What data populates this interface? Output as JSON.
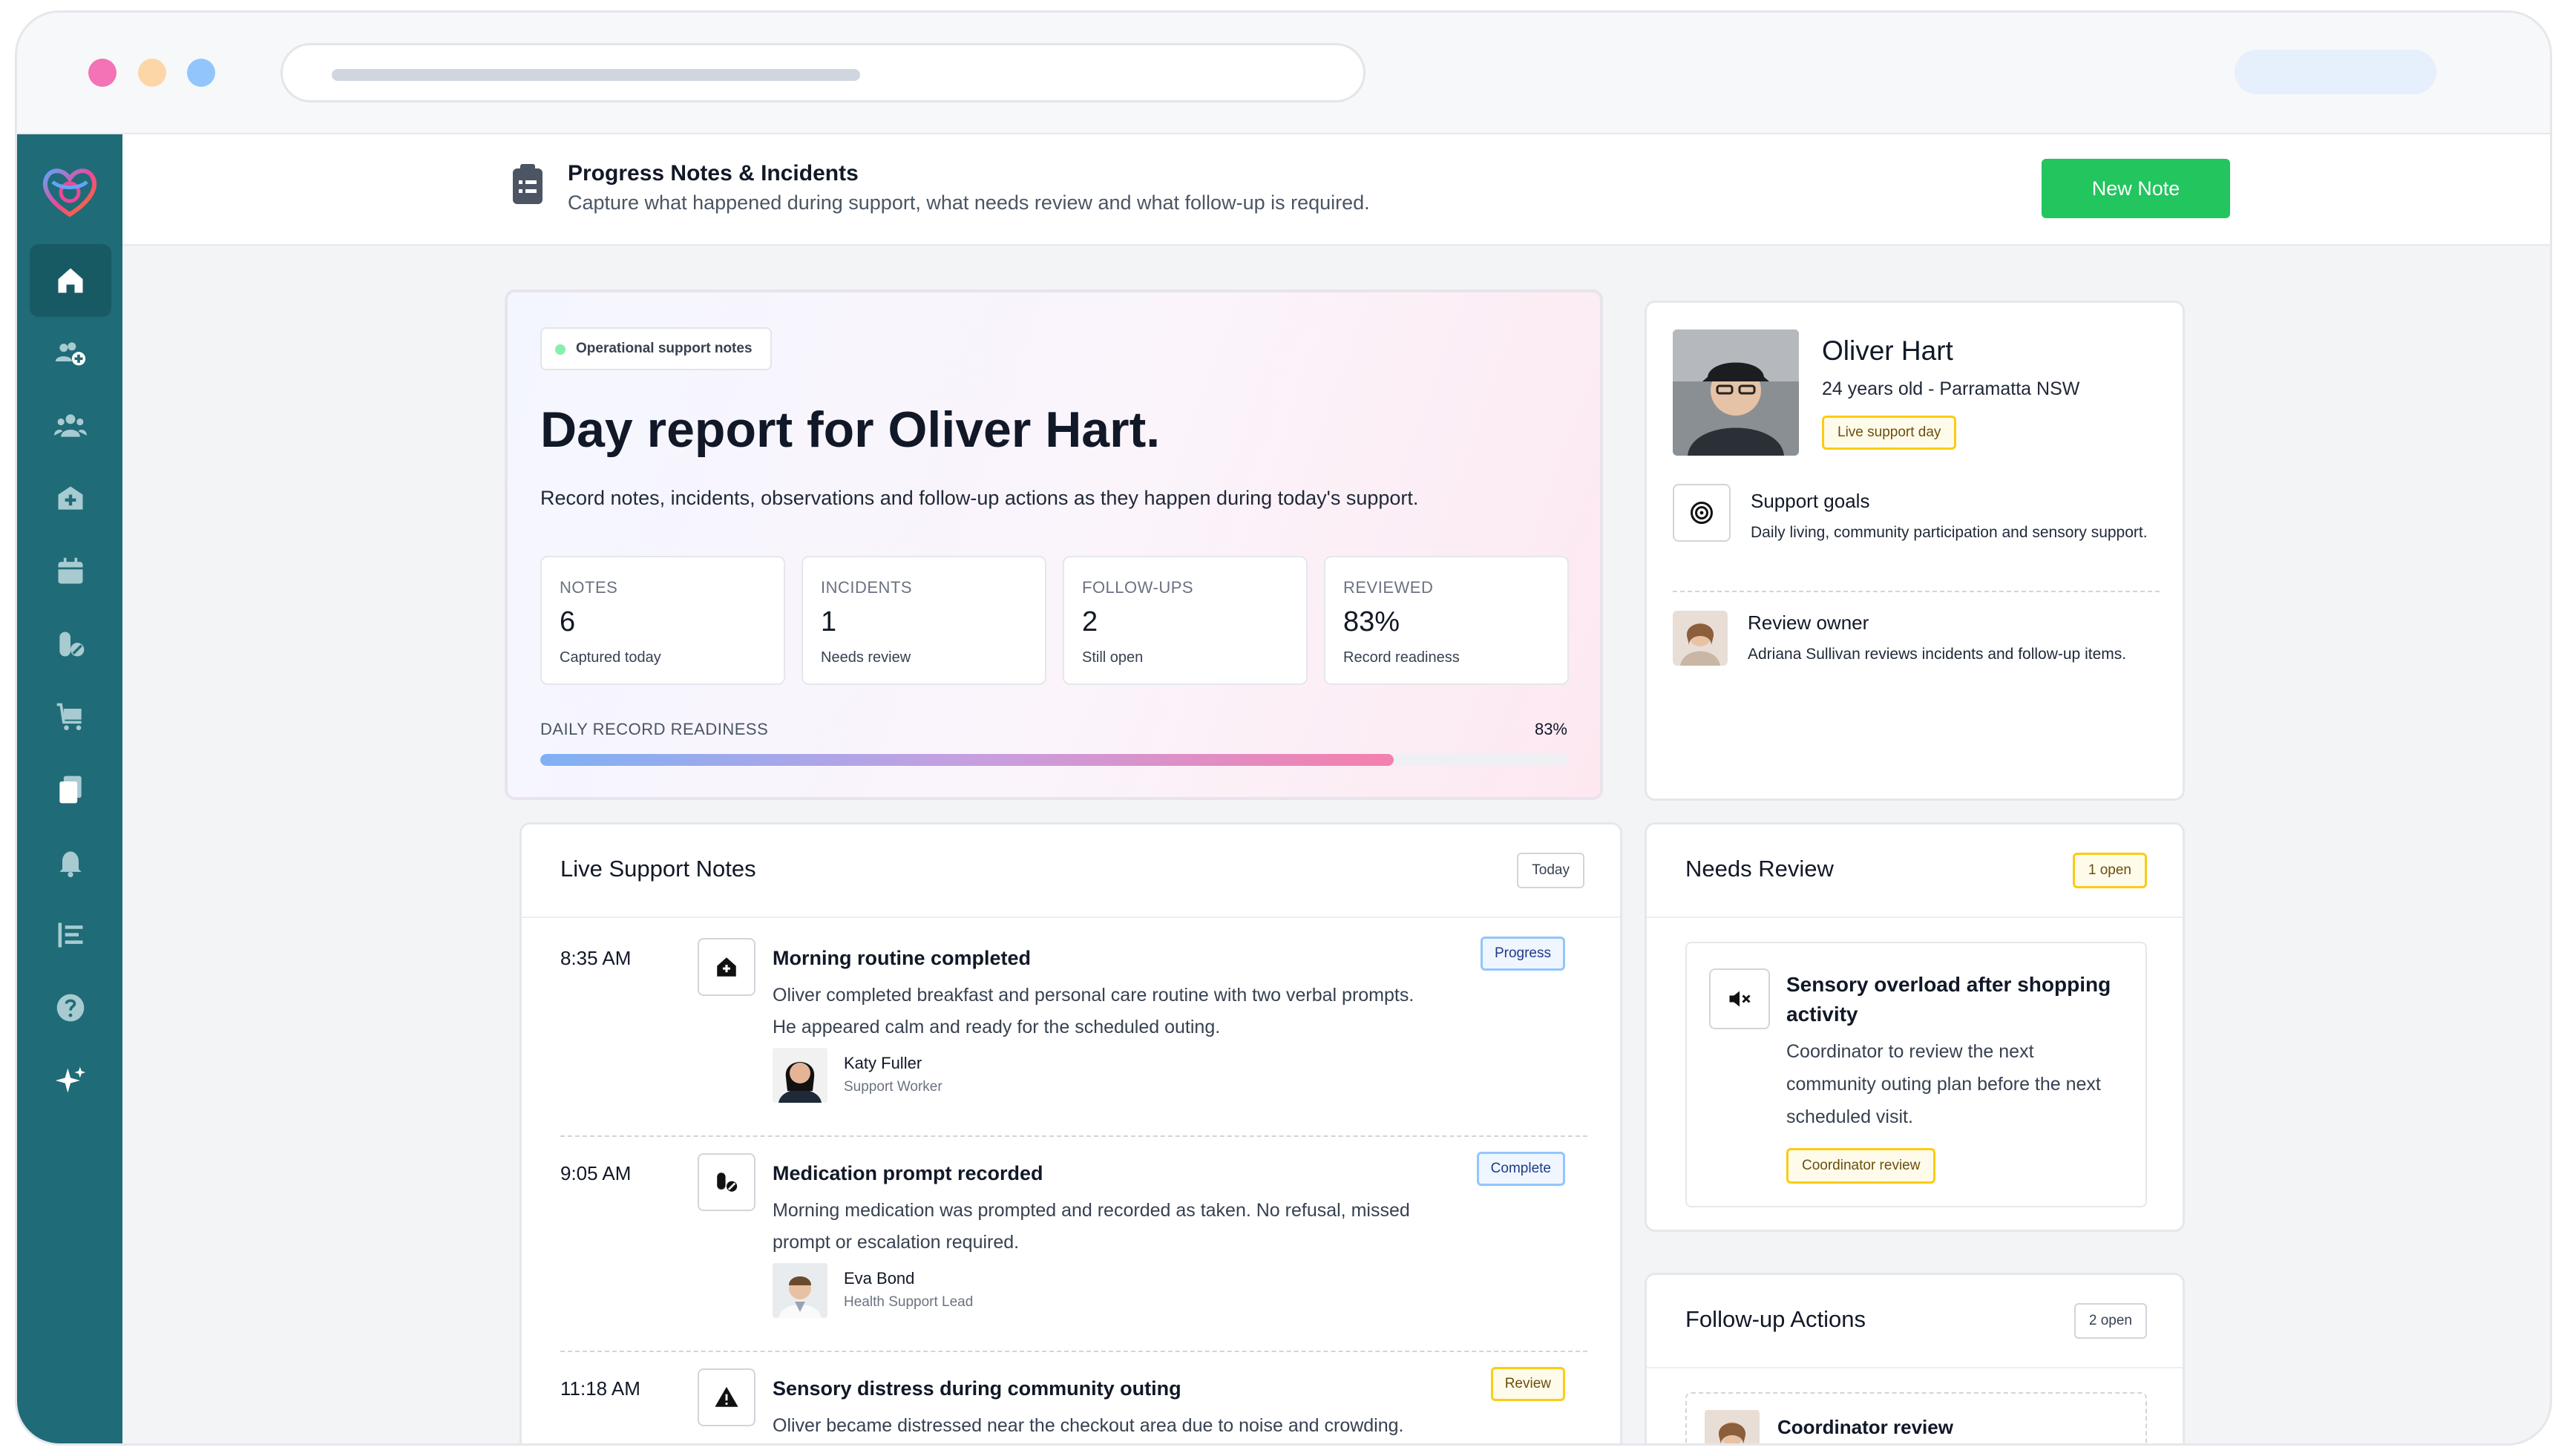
{
  "header": {
    "title": "Progress Notes & Incidents",
    "subtitle": "Capture what happened during support, what needs review and what follow-up is required.",
    "new_note_label": "New Note"
  },
  "sidebar": {
    "items": [
      {
        "icon": "home-icon",
        "active": true
      },
      {
        "icon": "add-participant-icon"
      },
      {
        "icon": "team-icon"
      },
      {
        "icon": "medical-kit-icon"
      },
      {
        "icon": "calendar-icon"
      },
      {
        "icon": "medication-icon"
      },
      {
        "icon": "cart-icon"
      },
      {
        "icon": "documents-icon"
      },
      {
        "icon": "bell-icon"
      },
      {
        "icon": "reports-icon"
      },
      {
        "icon": "help-icon"
      },
      {
        "icon": "sparkle-icon"
      }
    ]
  },
  "hero": {
    "badge": "Operational support notes",
    "title": "Day report for Oliver Hart.",
    "description": "Record notes, incidents, observations and follow-up actions as they happen during today's support.",
    "stats": [
      {
        "label": "NOTES",
        "value": "6",
        "sub": "Captured today"
      },
      {
        "label": "INCIDENTS",
        "value": "1",
        "sub": "Needs review"
      },
      {
        "label": "FOLLOW-UPS",
        "value": "2",
        "sub": "Still open"
      },
      {
        "label": "REVIEWED",
        "value": "83%",
        "sub": "Record readiness"
      }
    ],
    "readiness_label": "DAILY RECORD READINESS",
    "readiness_pct_text": "83%",
    "readiness_value": 0.83
  },
  "profile": {
    "name": "Oliver Hart",
    "details": "24 years old - Parramatta NSW",
    "badge": "Live support day",
    "goals_title": "Support goals",
    "goals_text": "Daily living, community participation and sensory support.",
    "owner_title": "Review owner",
    "owner_text": "Adriana Sullivan reviews incidents and follow-up items."
  },
  "notes": {
    "title": "Live Support Notes",
    "chip": "Today",
    "items": [
      {
        "time": "8:35 AM",
        "icon": "home-icon",
        "title": "Morning routine completed",
        "text": "Oliver completed breakfast and personal care routine with two verbal prompts. He appeared calm and ready for the scheduled outing.",
        "tag": "Progress",
        "person": "Katy Fuller",
        "role": "Support Worker"
      },
      {
        "time": "9:05 AM",
        "icon": "medication-icon",
        "title": "Medication prompt recorded",
        "text": "Morning medication was prompted and recorded as taken. No refusal, missed prompt or escalation required.",
        "tag": "Complete",
        "person": "Eva Bond",
        "role": "Health Support Lead"
      },
      {
        "time": "11:18 AM",
        "icon": "warning-icon",
        "title": "Sensory distress during community outing",
        "text": "Oliver became distressed near the checkout area due to noise and crowding. Katy moved him to a quiet space, paused the activity and returned home early.",
        "tag": "Review"
      }
    ]
  },
  "review": {
    "title": "Needs Review",
    "chip": "1 open",
    "item_title": "Sensory overload after shopping activity",
    "item_text": "Coordinator to review the next community outing plan before the next scheduled visit.",
    "item_tag": "Coordinator review"
  },
  "followup": {
    "title": "Follow-up Actions",
    "chip": "2 open",
    "item_title": "Coordinator review"
  },
  "colors": {
    "sidebar": "#1f6b77",
    "primary_button": "#22c55e",
    "review_tag": "#facc15",
    "progress_tag": "#93c5fd"
  }
}
